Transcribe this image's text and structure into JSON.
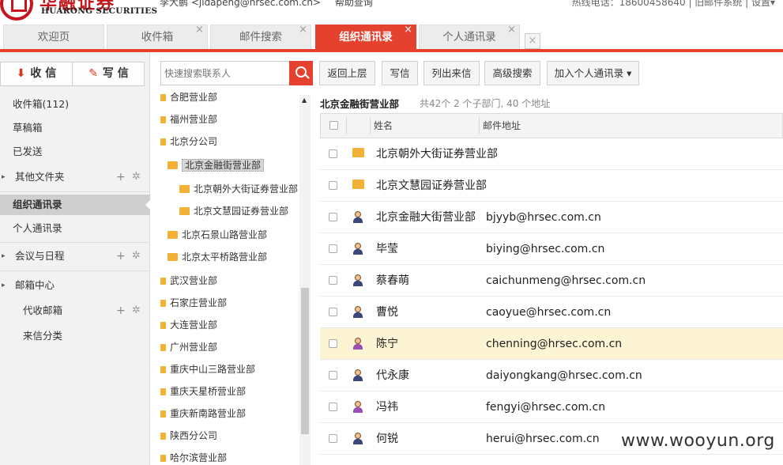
{
  "header": {
    "logo_cn": "华融证券",
    "logo_en": "HUARONG SECURITIES",
    "user_name": "李大鹏",
    "user_email": "<jidapeng@hrsec.com.cn>",
    "help_link": "帮助查询",
    "hotline": "热线电话：18600458640 | 旧邮件系统 | 设置▾"
  },
  "tabs": [
    {
      "label": "欢迎页"
    },
    {
      "label": "收件箱",
      "close": "×"
    },
    {
      "label": "邮件搜索",
      "close": "×"
    },
    {
      "label": "组织通讯录",
      "close": "×"
    },
    {
      "label": "个人通讯录",
      "close": "×"
    }
  ],
  "tab_closeall": "×",
  "sidebar": {
    "receive_label": "收 信",
    "receive_icon": "⬇",
    "write_label": "写 信",
    "write_icon": "✎",
    "items": [
      {
        "label": "收件箱(112)"
      },
      {
        "label": "草稿箱"
      },
      {
        "label": "已发送"
      },
      {
        "label": "其他文件夹",
        "caret": "▸",
        "plus": "+",
        "gear": "✲"
      },
      {
        "label": "组织通讯录"
      },
      {
        "label": "个人通讯录"
      },
      {
        "label": "会议与日程",
        "caret": "▸",
        "plus": "+",
        "gear": "✲"
      },
      {
        "label": "邮箱中心",
        "caret": "▸"
      },
      {
        "label": "代收邮箱",
        "plus": "+",
        "gear": "✲"
      },
      {
        "label": "来信分类"
      }
    ]
  },
  "search": {
    "placeholder": "快速搜索联系人"
  },
  "tree": [
    {
      "label": "合肥营业部"
    },
    {
      "label": "福州营业部"
    },
    {
      "label": "北京分公司"
    },
    {
      "label": "北京金融街营业部"
    },
    {
      "label": "北京朝外大街证券营业部"
    },
    {
      "label": "北京文慧园证券营业部"
    },
    {
      "label": "北京石景山路营业部"
    },
    {
      "label": "北京太平桥路营业部"
    },
    {
      "label": "武汉营业部"
    },
    {
      "label": "石家庄营业部"
    },
    {
      "label": "大连营业部"
    },
    {
      "label": "广州营业部"
    },
    {
      "label": "重庆中山三路营业部"
    },
    {
      "label": "重庆天星桥营业部"
    },
    {
      "label": "重庆新南路营业部"
    },
    {
      "label": "陕西分公司"
    },
    {
      "label": "哈尔滨营业部"
    }
  ],
  "tree_scroll_up": "▲",
  "toolbar": {
    "back": "返回上层",
    "write": "写信",
    "list_mail": "列出来信",
    "adv_search": "高级搜索",
    "add_personal": "加入个人通讯录 ▾"
  },
  "info": {
    "title": "北京金融街营业部",
    "summary": "共42个 2 个子部门, 40 个地址"
  },
  "columns": {
    "name": "姓名",
    "email": "邮件地址"
  },
  "rows": [
    {
      "type": "folder",
      "name": "北京朝外大街证券营业部",
      "email": ""
    },
    {
      "type": "folder",
      "name": "北京文慧园证券营业部",
      "email": ""
    },
    {
      "type": "male",
      "name": "北京金融大街营业部",
      "email": "bjyyb@hrsec.com.cn"
    },
    {
      "type": "male",
      "name": "毕莹",
      "email": "biying@hrsec.com.cn"
    },
    {
      "type": "male",
      "name": "蔡春萌",
      "email": "caichunmeng@hrsec.com.cn"
    },
    {
      "type": "male",
      "name": "曹悦",
      "email": "caoyue@hrsec.com.cn"
    },
    {
      "type": "female",
      "name": "陈宁",
      "email": "chenning@hrsec.com.cn",
      "highlight": true
    },
    {
      "type": "male",
      "name": "代永康",
      "email": "daiyongkang@hrsec.com.cn"
    },
    {
      "type": "female",
      "name": "冯祎",
      "email": "fengyi@hrsec.com.cn"
    },
    {
      "type": "male",
      "name": "何锐",
      "email": "herui@hrsec.com.cn"
    }
  ],
  "watermark": "www.wooyun.org",
  "colors": {
    "accent": "#e4422f",
    "brand": "#c4161c",
    "highlight_row": "#fdf4d3",
    "folder": "#f2b134"
  }
}
